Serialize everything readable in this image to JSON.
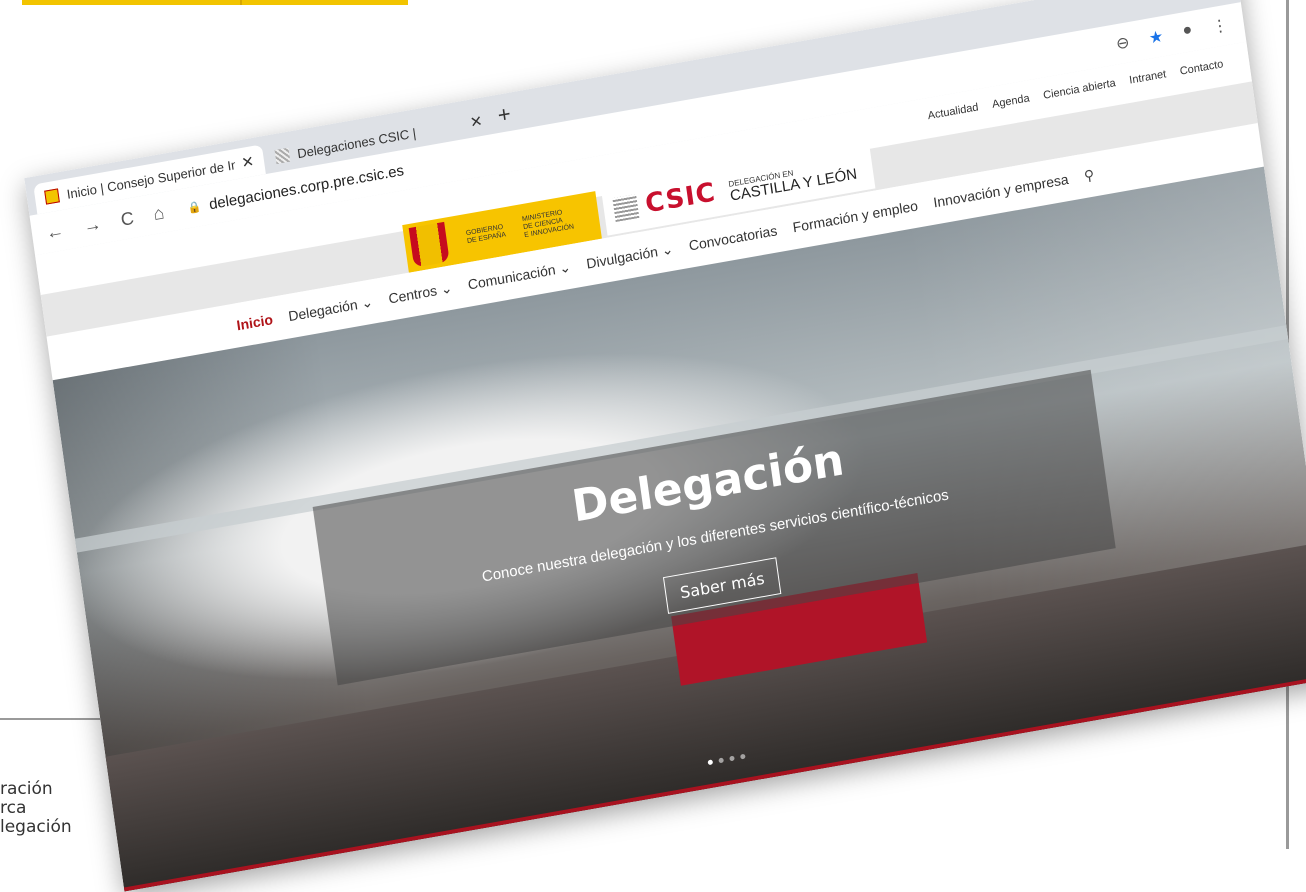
{
  "browser": {
    "tabs": [
      {
        "title": "Inicio | Consejo Superior de Inve",
        "close": "✕"
      },
      {
        "title": "Delegaciones CSIC |",
        "close": "✕"
      }
    ],
    "new_tab": "+",
    "window_controls": [
      "–",
      "▢",
      "✕"
    ],
    "nav_icons": [
      "←",
      "→",
      "C",
      "⌂"
    ],
    "url": "delegaciones.corp.pre.csic.es",
    "right_icons": [
      "⊖",
      "★",
      "●",
      "⋮"
    ]
  },
  "site": {
    "top_links": [
      "Actualidad",
      "Agenda",
      "Ciencia abierta",
      "Intranet",
      "Contacto"
    ],
    "logo_gov": {
      "line1": "GOBIERNO",
      "line2": "DE ESPAÑA",
      "line3": "MINISTERIO",
      "line4": "DE CIENCIA",
      "line5": "E INNOVACIÓN"
    },
    "logo_csic": {
      "name": "CSIC",
      "deleg_small": "DELEGACIÓN EN",
      "deleg_big": "CASTILLA Y LEÓN"
    },
    "menu": [
      {
        "label": "Inicio",
        "active": true
      },
      {
        "label": "Delegación ⌄"
      },
      {
        "label": "Centros ⌄"
      },
      {
        "label": "Comunicación ⌄"
      },
      {
        "label": "Divulgación ⌄"
      },
      {
        "label": "Convocatorias"
      },
      {
        "label": "Formación y empleo"
      },
      {
        "label": "Innovación y empresa"
      }
    ],
    "search_icon": "⚲"
  },
  "hero": {
    "title": "Delegación",
    "subtitle": "Conoce nuestra delegación y los diferentes servicios científico-técnicos",
    "cta": "Saber más"
  },
  "page_caption": [
    "ración",
    "rca",
    "legación"
  ],
  "colors": {
    "accent": "#b01419",
    "gov_yellow": "#f7c400",
    "csic_red": "#c8102e"
  }
}
